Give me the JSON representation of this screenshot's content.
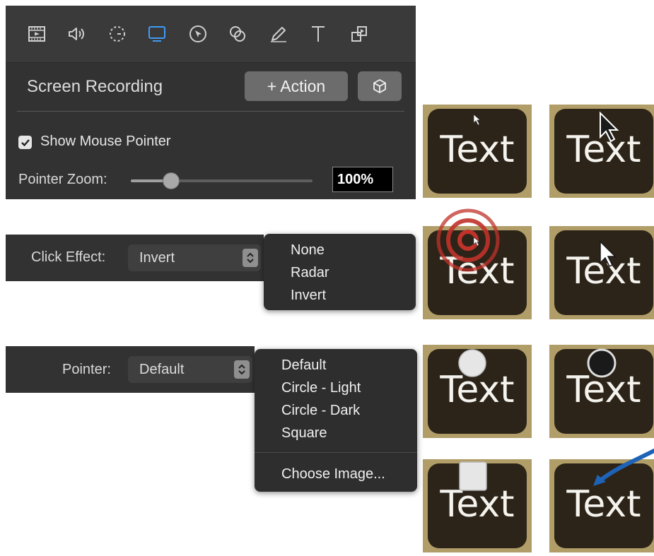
{
  "toolbar": {
    "tools": [
      {
        "icon": "film-icon",
        "active": false
      },
      {
        "icon": "speaker-icon",
        "active": false
      },
      {
        "icon": "timer-icon",
        "active": false
      },
      {
        "icon": "screen-icon",
        "active": true
      },
      {
        "icon": "cursor-circle-icon",
        "active": false
      },
      {
        "icon": "overlap-circles-icon",
        "active": false
      },
      {
        "icon": "pencil-icon",
        "active": false
      },
      {
        "icon": "text-icon",
        "active": false
      },
      {
        "icon": "layers-icon",
        "active": false
      }
    ],
    "active_color": "#3f9bf6",
    "icon_color": "#cfcfcf"
  },
  "panel": {
    "title": "Screen Recording",
    "action_label": "+ Action",
    "cube_icon": "cube-icon",
    "show_mouse_pointer": {
      "label": "Show Mouse Pointer",
      "checked": true
    },
    "pointer_zoom": {
      "label": "Pointer Zoom:",
      "level": 0.22,
      "value": "100%"
    }
  },
  "click_effect": {
    "label": "Click Effect:",
    "selected": "Invert",
    "options": [
      "None",
      "Radar",
      "Invert"
    ]
  },
  "pointer": {
    "label": "Pointer:",
    "selected": "Default",
    "options": [
      "Default",
      "Circle - Light",
      "Circle - Dark",
      "Square"
    ],
    "extra_option": "Choose Image..."
  },
  "thumbnails": [
    {
      "text": "Text",
      "overlay": "small-arrow-pointer"
    },
    {
      "text": "Text",
      "overlay": "large-arrow-pointer"
    },
    {
      "text": "Text",
      "overlay": "radar-click-effect"
    },
    {
      "text": "Text",
      "overlay": "invert-pointer"
    },
    {
      "text": "Text",
      "overlay": "light-circle-pointer"
    },
    {
      "text": "Text",
      "overlay": "dark-circle-pointer"
    },
    {
      "text": "Text",
      "overlay": "square-pointer"
    },
    {
      "text": "Text",
      "overlay": "custom-image-pointer"
    }
  ],
  "colors": {
    "panel_bg": "#323232",
    "thumb_frame": "#b19d68",
    "thumb_bg": "#2c2419",
    "radar": "#c0322a",
    "custom_arrow": "#1e63b7"
  }
}
